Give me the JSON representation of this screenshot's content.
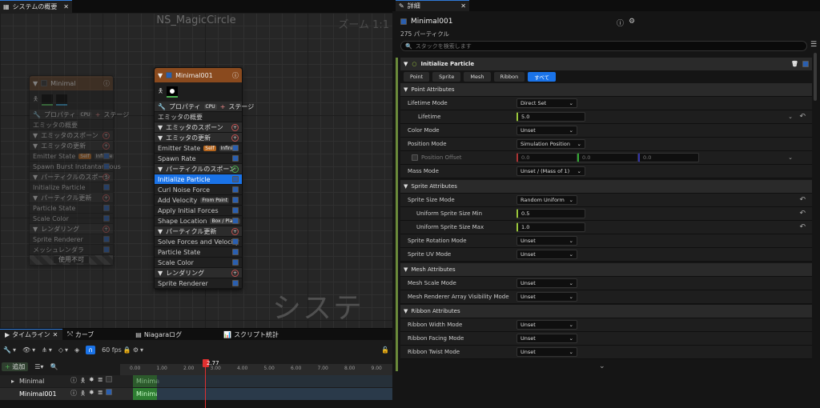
{
  "left_tab": {
    "title": "システムの概要"
  },
  "graph": {
    "title": "NS_MagicCircle",
    "zoom": "ズーム 1:1",
    "watermark": "システム"
  },
  "node_disabled": {
    "title": "Minimal",
    "properties": "プロパティ",
    "stage": "ステージ",
    "rows": [
      {
        "label": "エミッタの概要",
        "type": "item"
      },
      {
        "label": "エミッタのスポーン",
        "type": "sec"
      },
      {
        "label": "エミッタの更新",
        "type": "sec"
      },
      {
        "label": "Emitter State",
        "type": "item",
        "badge1": "Self",
        "badge2": "Infinite"
      },
      {
        "label": "Spawn Burst Instantaneous",
        "type": "item"
      },
      {
        "label": "パーティクルのスポーン",
        "type": "sec"
      },
      {
        "label": "Initialize Particle",
        "type": "item"
      },
      {
        "label": "パーティクル更新",
        "type": "sec"
      },
      {
        "label": "Particle State",
        "type": "item"
      },
      {
        "label": "Scale Color",
        "type": "item"
      },
      {
        "label": "レンダリング",
        "type": "sec"
      },
      {
        "label": "Sprite Renderer",
        "type": "item"
      },
      {
        "label": "メッシュレンダラ",
        "type": "item"
      }
    ],
    "footer": "使用不可"
  },
  "node_active": {
    "title": "Minimal001",
    "properties": "プロパティ",
    "stage": "ステージ",
    "rows": [
      {
        "label": "エミッタの概要",
        "type": "item"
      },
      {
        "label": "エミッタのスポーン",
        "type": "sec"
      },
      {
        "label": "エミッタの更新",
        "type": "sec"
      },
      {
        "label": "Emitter State",
        "type": "item",
        "badge1": "Self",
        "badge2": "Infinite"
      },
      {
        "label": "Spawn Rate",
        "type": "item"
      },
      {
        "label": "パーティクルのスポーン",
        "type": "sec"
      },
      {
        "label": "Initialize Particle",
        "type": "item",
        "selected": true
      },
      {
        "label": "Curl Noise Force",
        "type": "item"
      },
      {
        "label": "Add Velocity",
        "type": "item",
        "badge1": "From Point"
      },
      {
        "label": "Apply Initial Forces",
        "type": "item"
      },
      {
        "label": "Shape Location",
        "type": "item",
        "badge1": "Box / Plane"
      },
      {
        "label": "パーティクル更新",
        "type": "sec"
      },
      {
        "label": "Solve Forces and Velocity",
        "type": "item"
      },
      {
        "label": "Particle State",
        "type": "item"
      },
      {
        "label": "Scale Color",
        "type": "item"
      },
      {
        "label": "レンダリング",
        "type": "sec"
      },
      {
        "label": "Sprite Renderer",
        "type": "item"
      }
    ]
  },
  "timeline": {
    "tabs": [
      "タイムライン",
      "カーブ",
      "Niagaraログ",
      "スクリプト統計"
    ],
    "fps": "60 fps",
    "add": "追加",
    "playhead": "2.77",
    "ticks": [
      "0.00",
      "1.00",
      "2.00",
      "3.00",
      "4.00",
      "5.00",
      "6.00",
      "7.00",
      "8.00",
      "9.00"
    ],
    "tracks": [
      {
        "name": "Minimal",
        "bar": "Minima"
      },
      {
        "name": "Minimal001",
        "bar": "Minima"
      }
    ]
  },
  "details": {
    "tab": "詳細",
    "emitter_name": "Minimal001",
    "particle_count": "275 パーティクル",
    "search_placeholder": "スタックを検索します",
    "module_title": "Initialize Particle",
    "type_tabs": [
      "Point",
      "Sprite",
      "Mesh",
      "Ribbon",
      "すべて"
    ],
    "sections": {
      "point": "Point Attributes",
      "sprite": "Sprite Attributes",
      "mesh": "Mesh Attributes",
      "ribbon": "Ribbon Attributes"
    },
    "props": {
      "lifetime_mode": {
        "label": "Lifetime Mode",
        "value": "Direct Set"
      },
      "lifetime": {
        "label": "Lifetime",
        "value": "5.0"
      },
      "color_mode": {
        "label": "Color Mode",
        "value": "Unset"
      },
      "position_mode": {
        "label": "Position Mode",
        "value": "Simulation Position"
      },
      "position_offset": {
        "label": "Position Offset",
        "x": "0.0",
        "y": "0.0",
        "z": "0.0"
      },
      "mass_mode": {
        "label": "Mass Mode",
        "value": "Unset / (Mass of 1)"
      },
      "sprite_size_mode": {
        "label": "Sprite Size Mode",
        "value": "Random Uniform"
      },
      "size_min": {
        "label": "Uniform Sprite Size Min",
        "value": "0.5"
      },
      "size_max": {
        "label": "Uniform Sprite Size Max",
        "value": "1.0"
      },
      "sprite_rotation": {
        "label": "Sprite Rotation Mode",
        "value": "Unset"
      },
      "sprite_uv": {
        "label": "Sprite UV Mode",
        "value": "Unset"
      },
      "mesh_scale": {
        "label": "Mesh Scale Mode",
        "value": "Unset"
      },
      "mesh_vis": {
        "label": "Mesh Renderer Array Visibility Mode",
        "value": "Unset"
      },
      "ribbon_width": {
        "label": "Ribbon Width Mode",
        "value": "Unset"
      },
      "ribbon_facing": {
        "label": "Ribbon Facing Mode",
        "value": "Unset"
      },
      "ribbon_twist": {
        "label": "Ribbon Twist Mode",
        "value": "Unset"
      }
    }
  }
}
